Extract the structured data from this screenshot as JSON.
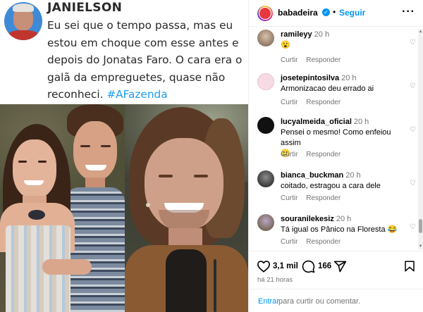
{
  "tweet": {
    "author": "JANIELSON",
    "text_main": "Eu sei que o tempo passa, mas eu estou em choque com esse antes e depois do Jonatas Faro. O cara era o galã da empreguetes, quase não reconheci.",
    "hashtag": "#AFazenda"
  },
  "post_header": {
    "username": "babadeira",
    "separator": "•",
    "follow_label": "Seguir",
    "more_label": "···"
  },
  "comments": [
    {
      "user": "ramileyy",
      "time": "20 h",
      "text": "",
      "emoji": "😮",
      "reply_label": "Responder",
      "like_label": "Curtir"
    },
    {
      "user": "josetepintosilva",
      "time": "20 h",
      "text": "Armonizacao deu errado ai",
      "reply_label": "Responder",
      "like_label": "Curtir"
    },
    {
      "user": "lucyalmeida_oficial",
      "time": "20 h",
      "text": "Pensei o mesmo! Como enfeiou assim",
      "emoji": "🥲",
      "reply_label": "Responder",
      "like_label": "Curtir"
    },
    {
      "user": "bianca_buckman",
      "time": "20 h",
      "text": "coitado, estragou a cara dele",
      "reply_label": "Responder",
      "like_label": "Curtir"
    },
    {
      "user": "souranilekesiz",
      "time": "20 h",
      "text": "Tá igual os Pânico na Floresta",
      "emoji": "😂",
      "reply_label": "Responder",
      "like_label": "Curtir"
    }
  ],
  "action_bar": {
    "likes": "3,1 mil",
    "comments": "166",
    "posted": "há 21 horas"
  },
  "login_bar": {
    "link": "Entrar",
    "rest": "para curtir ou comentar."
  },
  "colors": {
    "link": "#0095f6",
    "hashtag": "#1d9bf0",
    "muted": "#737373"
  },
  "icons": {
    "verified": "verified-badge-icon",
    "more": "more-options-icon",
    "heart": "heart-icon",
    "comment": "comment-icon",
    "share": "share-icon",
    "save": "bookmark-icon"
  }
}
